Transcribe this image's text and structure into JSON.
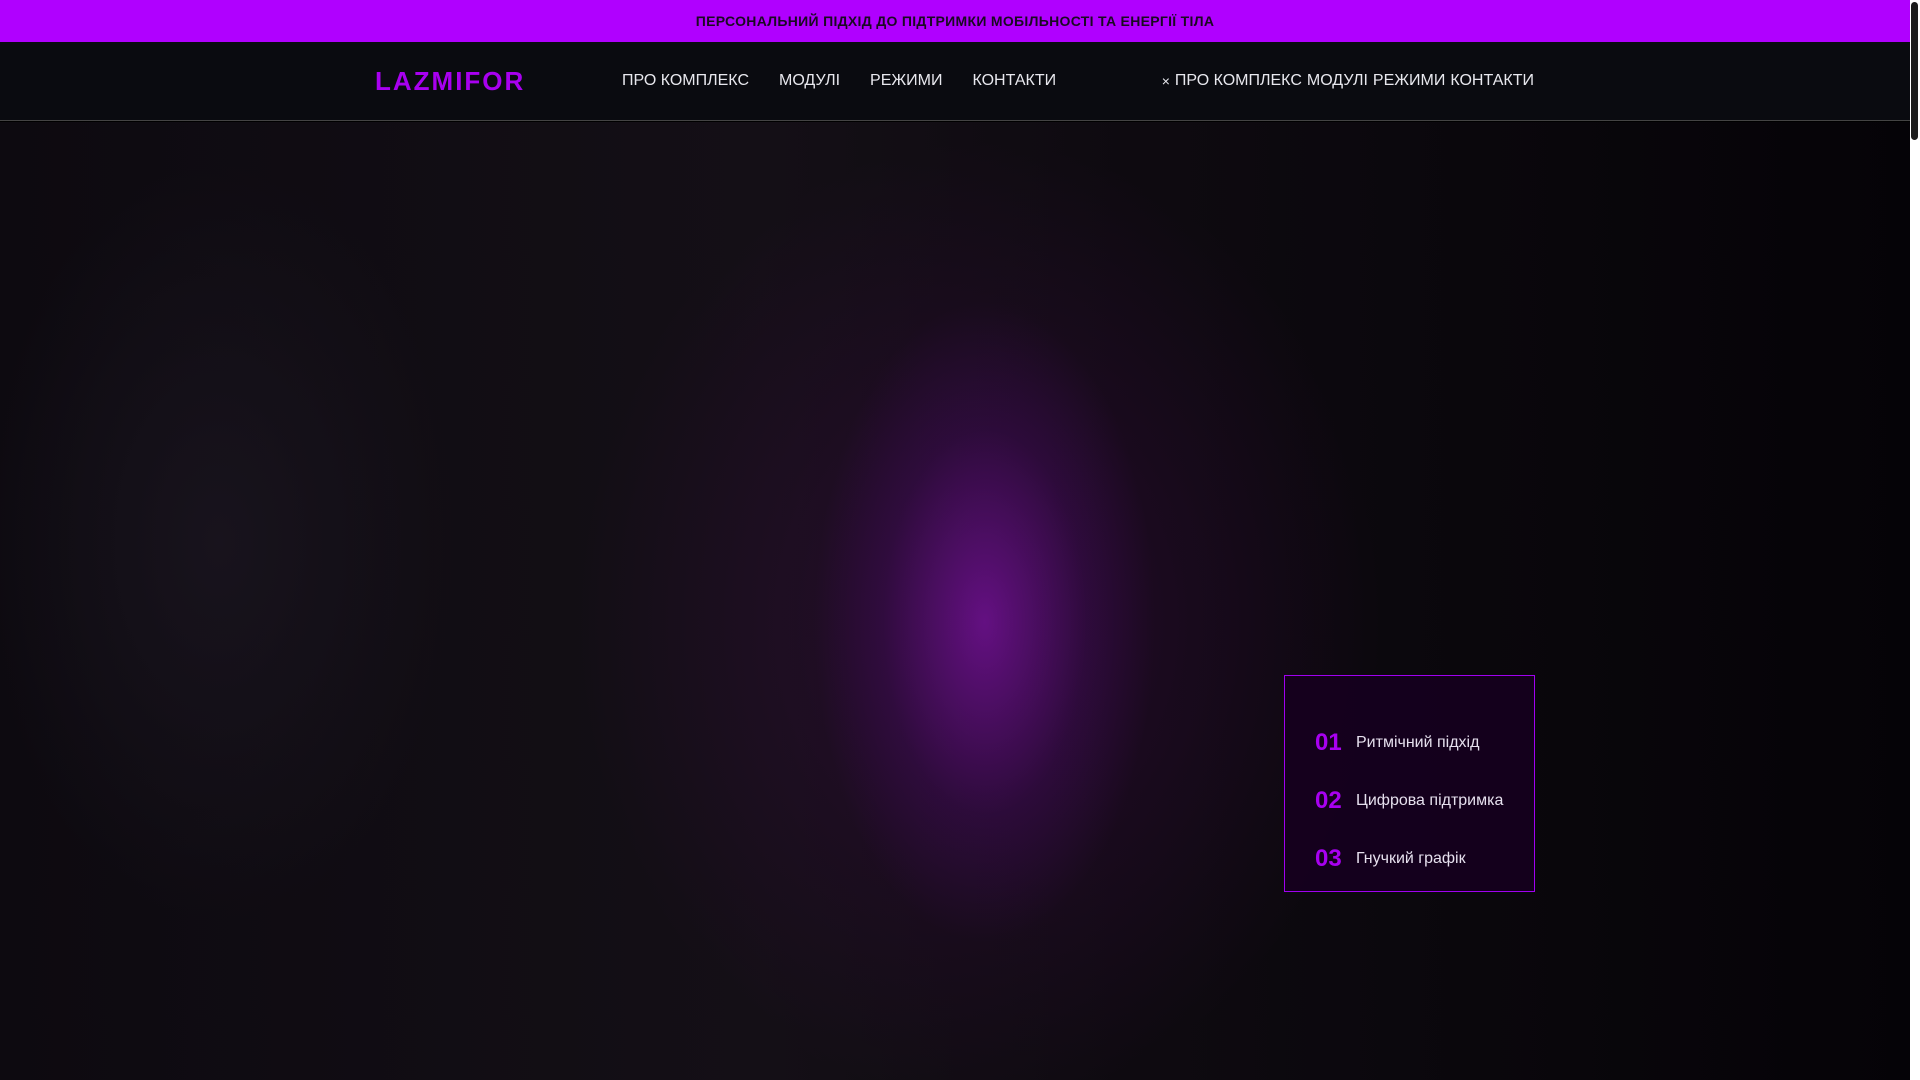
{
  "announcement": "ПЕРСОНАЛЬНИЙ ПІДХІД ДО ПІДТРИМКИ МОБІЛЬНОСТІ ТА ЕНЕРГІЇ ТІЛА",
  "header": {
    "logo": "LAZMIFOR",
    "nav": [
      "ПРО КОМПЛЕКС",
      "МОДУЛІ",
      "РЕЖИМИ",
      "КОНТАКТИ"
    ],
    "mobile_nav": {
      "close": "×",
      "items": [
        "ПРО КОМПЛЕКС",
        "МОДУЛІ",
        "РЕЖИМИ",
        "КОНТАКТИ"
      ]
    }
  },
  "hero": {
    "features": [
      {
        "num": "01",
        "label": "Ритмічний підхід"
      },
      {
        "num": "02",
        "label": "Цифрова підтримка"
      },
      {
        "num": "03",
        "label": "Гнучкий графік"
      }
    ]
  },
  "colors": {
    "accent": "#b000ff",
    "header_bg": "#0a0b10"
  }
}
